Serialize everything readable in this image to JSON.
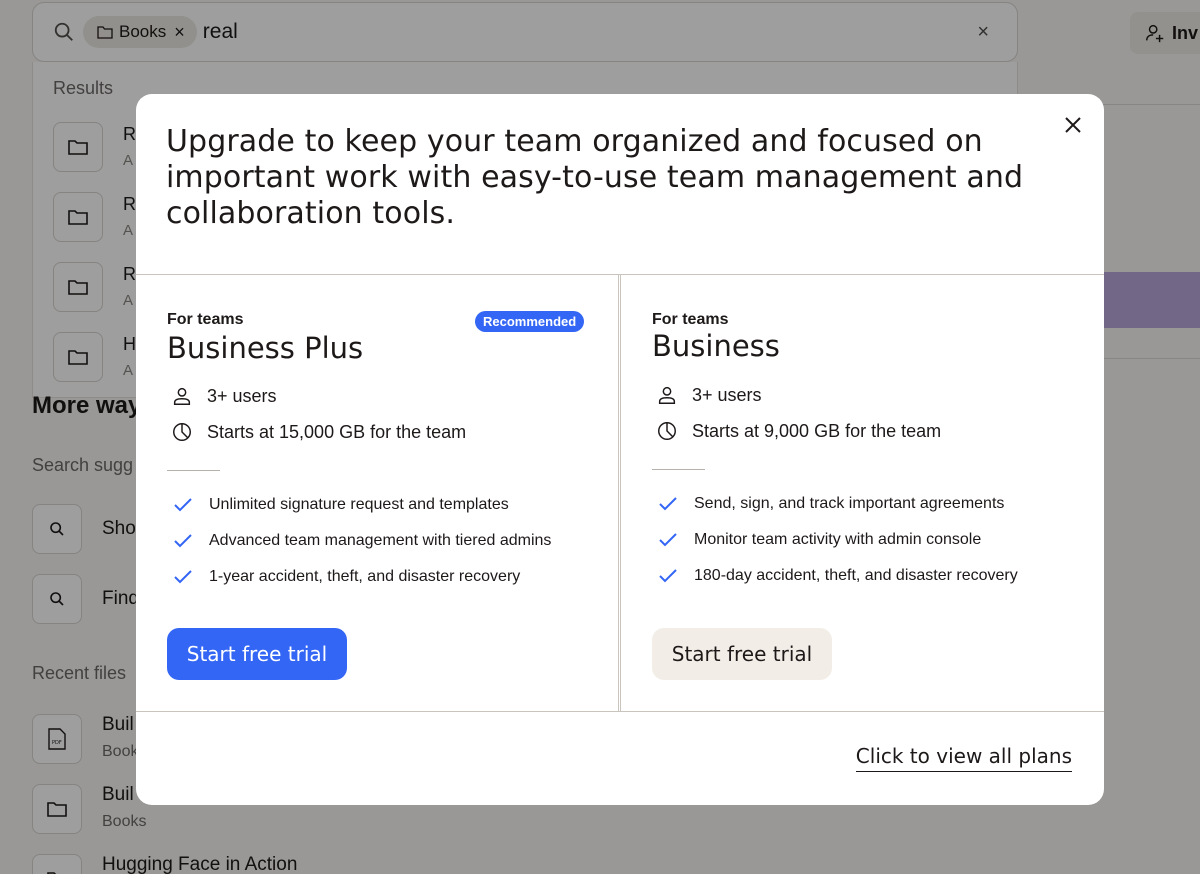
{
  "background": {
    "search": {
      "filter_chip": "Books",
      "query": "real"
    },
    "invite_button": "Inv",
    "results_title": "Results",
    "result_rows": [
      {
        "letter": "R",
        "sub": "A"
      },
      {
        "letter": "R",
        "sub": "A"
      },
      {
        "letter": "R",
        "sub": "A"
      },
      {
        "letter": "H",
        "sub": "A"
      }
    ],
    "more_ways_heading": "More way",
    "search_suggestions_label": "Search sugg",
    "suggestions": [
      "Sho",
      "Find"
    ],
    "recent_files_label": "Recent files",
    "recent_files": [
      {
        "title": "Buil",
        "sub": "Book"
      },
      {
        "title": "Buil",
        "sub": "Books"
      },
      {
        "title": "Hugging Face in Action",
        "sub": ""
      }
    ]
  },
  "modal": {
    "headline": "Upgrade to keep your team organized and focused on important work with easy-to-use team management and collaboration tools.",
    "plans": [
      {
        "eyebrow": "For teams",
        "name": "Business Plus",
        "badge": "Recommended",
        "users": "3+ users",
        "storage": "Starts at 15,000 GB for the team",
        "features": [
          "Unlimited signature request and templates",
          "Advanced team management with tiered admins",
          "1-year accident, theft, and disaster recovery"
        ],
        "cta": "Start free trial"
      },
      {
        "eyebrow": "For teams",
        "name": "Business",
        "users": "3+ users",
        "storage": "Starts at 9,000 GB for the team",
        "features": [
          "Send, sign, and track important agreements",
          "Monitor team activity with admin console",
          "180-day accident, theft, and disaster recovery"
        ],
        "cta": "Start free trial"
      }
    ],
    "view_all_link": "Click to view all plans"
  },
  "colors": {
    "primary": "#3466f5",
    "secondary_button": "#f2ede7",
    "text": "#1e1919"
  },
  "icons": [
    "search-icon",
    "folder-icon",
    "close-icon",
    "user-icon",
    "pie-chart-icon",
    "check-icon",
    "add-user-icon"
  ]
}
